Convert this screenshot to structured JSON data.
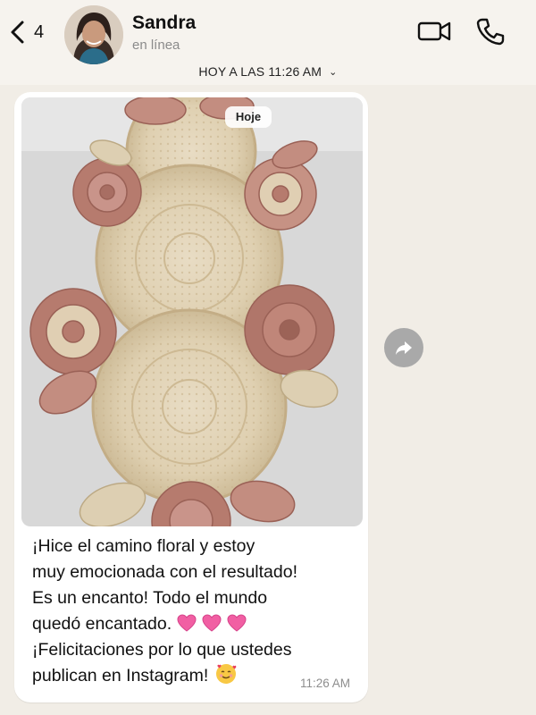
{
  "header": {
    "back_count": "4",
    "contact_name": "Sandra",
    "contact_status": "en línea",
    "icons": [
      "chevron-left-icon",
      "video-camera-icon",
      "phone-icon"
    ]
  },
  "date_label": "HOY A LAS 11:26 AM",
  "message": {
    "photo_badge": "Hoje",
    "lines": [
      "¡Hice el camino floral y estoy",
      "muy emocionada con el resultado!",
      "Es un encanto! Todo el mundo",
      "quedó encantado.",
      "¡Felicitaciones por lo que ustedes",
      "publican en Instagram!"
    ],
    "time": "11:26 AM",
    "emoji": [
      "pink-heart-emoji",
      "pink-heart-emoji",
      "pink-heart-emoji",
      "smiling-face-with-hearts-emoji"
    ]
  },
  "colors": {
    "background": "#f1ede6",
    "bubble": "#ffffff",
    "doily_cream": "#e2d3b6",
    "doily_rose": "#b67b6e",
    "forward_button": "#a9a9a9"
  }
}
